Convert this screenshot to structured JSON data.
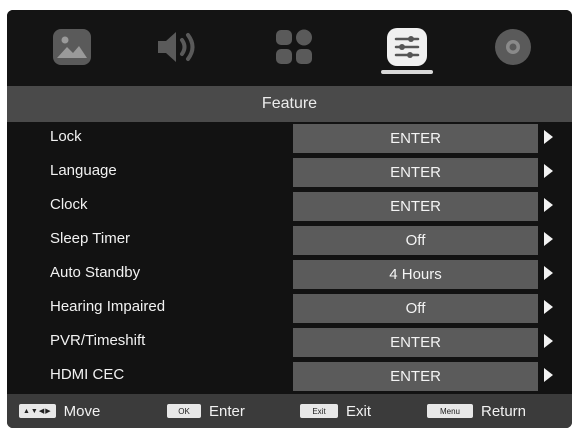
{
  "tabs": [
    {
      "name": "picture",
      "icon": "picture-icon"
    },
    {
      "name": "sound",
      "icon": "speaker-icon"
    },
    {
      "name": "apps",
      "icon": "apps-icon"
    },
    {
      "name": "feature",
      "icon": "sliders-icon",
      "selected": true
    },
    {
      "name": "setup",
      "icon": "gear-circle-icon"
    }
  ],
  "title": "Feature",
  "menu": {
    "items": [
      {
        "label": "Lock",
        "value": "ENTER"
      },
      {
        "label": "Language",
        "value": "ENTER"
      },
      {
        "label": "Clock",
        "value": "ENTER"
      },
      {
        "label": "Sleep Timer",
        "value": "Off"
      },
      {
        "label": "Auto Standby",
        "value": "4 Hours"
      },
      {
        "label": "Hearing Impaired",
        "value": "Off"
      },
      {
        "label": "PVR/Timeshift",
        "value": "ENTER"
      },
      {
        "label": "HDMI CEC",
        "value": "ENTER"
      }
    ]
  },
  "hints": {
    "move_key": "▲▼◀▶",
    "move": "Move",
    "ok_key": "OK",
    "enter": "Enter",
    "exit_key": "Exit",
    "exit": "Exit",
    "menu_key": "Menu",
    "return": "Return"
  },
  "colors": {
    "background": "#111111",
    "title_bar": "#4a4a4a",
    "value_box": "#5b5b5b",
    "hint_bar": "#3b3b3b",
    "icon": "#5a5a5a",
    "selected_icon": "#f0f0f0"
  }
}
